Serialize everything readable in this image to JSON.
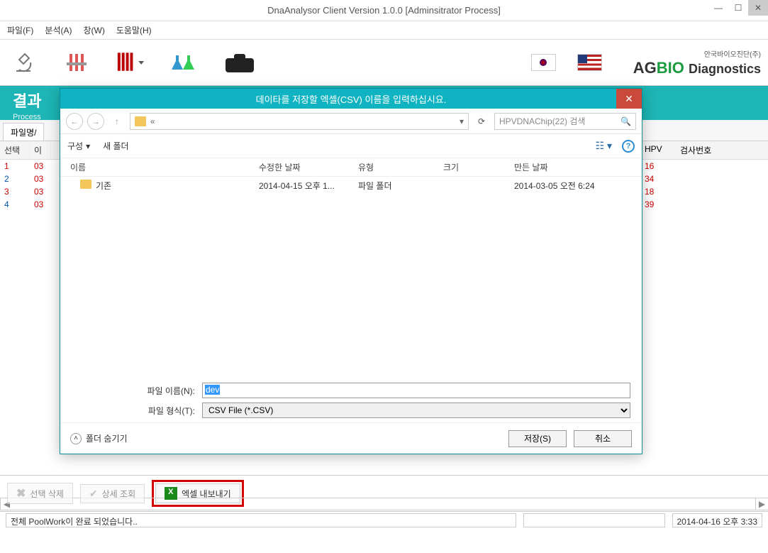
{
  "window": {
    "title": "DnaAnalysor Client Version 1.0.0 [Adminsitrator Process]"
  },
  "menu": {
    "file": "파일(F)",
    "analysis": "분석(A)",
    "window": "창(W)",
    "help": "도움말(H)"
  },
  "brand": {
    "name_a": "AG",
    "name_b": "BIO",
    "sub": "Diagnostics",
    "sub2": "안국바이오진단(주)"
  },
  "section": {
    "title": "결과",
    "subtitle": "Process"
  },
  "tab": {
    "label": "파일명/"
  },
  "grid": {
    "headers": {
      "select": "선택",
      "id": "이",
      "hpv": "HPV",
      "testno": "검사번호"
    },
    "rows": [
      {
        "n": "1",
        "id": "03",
        "hpv": "16"
      },
      {
        "n": "2",
        "id": "03",
        "hpv": "34"
      },
      {
        "n": "3",
        "id": "03",
        "hpv": "18"
      },
      {
        "n": "4",
        "id": "03",
        "hpv": "39"
      }
    ]
  },
  "buttons": {
    "delete": "선택 삭제",
    "detail": "상세 조회",
    "export": "엑셀 내보내기"
  },
  "status": {
    "message": "전체 PoolWork이 완료 되었습니다..",
    "time": "2014-04-16 오후 3:33"
  },
  "dialog": {
    "title": "데이타를 저장할 엑셀(CSV) 이름을 입력하십시요.",
    "search_placeholder": "HPVDNAChip(22) 검색",
    "organize": "구성",
    "newfolder": "새 폴더",
    "cols": {
      "name": "이름",
      "modified": "수정한 날짜",
      "type": "유형",
      "size": "크기",
      "created": "만든 날짜"
    },
    "items": [
      {
        "name": "기존",
        "modified": "2014-04-15 오후 1...",
        "type": "파일 폴더",
        "size": "",
        "created": "2014-03-05 오전 6:24"
      }
    ],
    "filename_label": "파일 이름(N):",
    "filename_value": "dev",
    "filetype_label": "파일 형식(T):",
    "filetype_value": "CSV File (*.CSV)",
    "hide_folders": "폴더 숨기기",
    "save": "저장(S)",
    "cancel": "취소",
    "breadcrumb_prefix": "«"
  }
}
